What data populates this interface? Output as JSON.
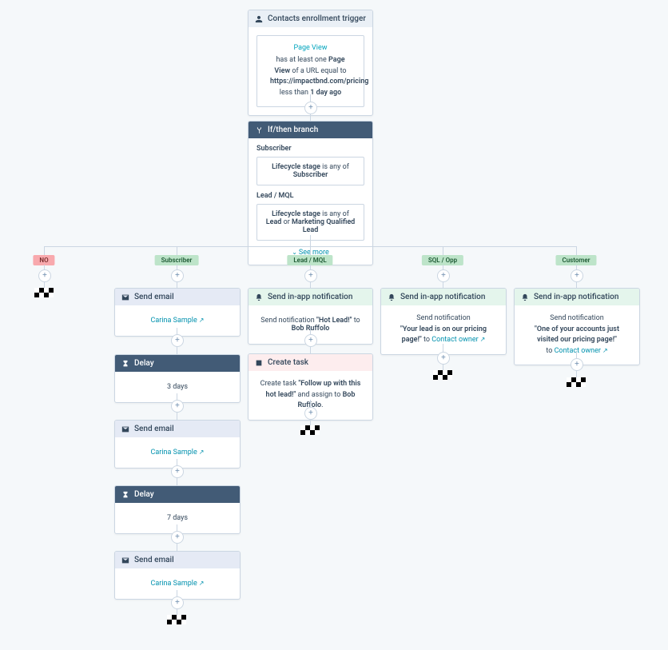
{
  "trigger": {
    "title": "Contacts enrollment trigger",
    "pageViewLabel": "Page View",
    "line1a": "has at least one ",
    "line1b": "Page View",
    "line1c": " of a URL equal to ",
    "url": "https://impactbnd.com/pricing",
    "line2a": " less than ",
    "time": "1 day ago"
  },
  "branch": {
    "title": "If/then branch",
    "group1_label": "Subscriber",
    "group1_prop": "Lifecycle stage",
    "group1_mid": " is any of ",
    "group1_val": "Subscriber",
    "group2_label": "Lead / MQL",
    "group2_prop": "Lifecycle stage",
    "group2_mid": " is any of ",
    "group2_val": "Lead",
    "group2_or": " or ",
    "group2_val2": "Marketing Qualified Lead",
    "see_more": "See more"
  },
  "pills": {
    "no": "NO",
    "subscriber": "Subscriber",
    "lead": "Lead / MQL",
    "sql": "SQL / Opp",
    "customer": "Customer"
  },
  "subscriber": {
    "email1_title": "Send email",
    "email1_link": "Carina Sample",
    "delay1_title": "Delay",
    "delay1_text": "3 days",
    "email2_title": "Send email",
    "email2_link": "Carina Sample",
    "delay2_title": "Delay",
    "delay2_text": "7 days",
    "email3_title": "Send email",
    "email3_link": "Carina Sample"
  },
  "lead": {
    "notif_title": "Send in-app notification",
    "notif_pre": "Send notification ",
    "notif_quote": "\"Hot Lead!\"",
    "notif_mid": " to ",
    "notif_to": "Bob Ruffolo",
    "task_title": "Create task",
    "task_pre": "Create task ",
    "task_quote": "\"Follow up with this hot lead!\"",
    "task_mid": " and assign to ",
    "task_to": "Bob Ruffolo"
  },
  "sql": {
    "notif_title": "Send in-app notification",
    "line1": "Send notification",
    "quote": "\"Your lead is on our pricing page!\"",
    "mid": " to ",
    "owner": "Contact owner"
  },
  "customer": {
    "notif_title": "Send in-app notification",
    "line1": "Send notification",
    "quote": "\"One of your accounts just visited our pricing page!\"",
    "mid": "to ",
    "owner": "Contact owner"
  }
}
